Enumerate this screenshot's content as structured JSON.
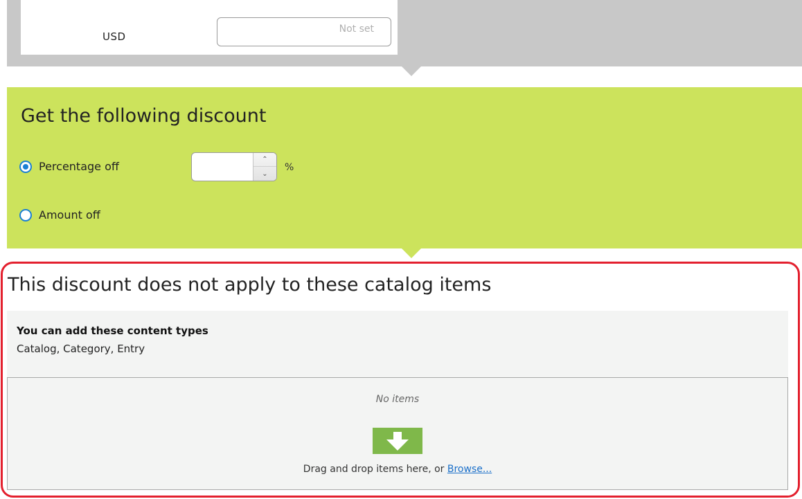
{
  "currency": {
    "code": "USD",
    "value": "",
    "placeholder": "Not set"
  },
  "discount": {
    "title": "Get the following discount",
    "options": [
      {
        "label": "Percentage off",
        "selected": true
      },
      {
        "label": "Amount off",
        "selected": false
      }
    ],
    "percentage_value": "",
    "percentage_unit": "%",
    "stepper_up_glyph": "⌃",
    "stepper_down_glyph": "⌄"
  },
  "exclusions": {
    "title": "This discount does not apply to these catalog items",
    "content_types_heading": "You can add these content types",
    "content_types": "Catalog, Category, Entry",
    "empty_text": "No items",
    "drop_text": "Drag and drop items here, or",
    "browse_label": "Browse..."
  },
  "colors": {
    "discount_panel": "#cce35c",
    "highlight_outline": "#e3202e",
    "drop_icon": "#7fb84a",
    "radio_accent": "#1a7fd4",
    "link": "#1a6fc9"
  },
  "icons": {
    "drop_icon": "download-arrow-icon"
  }
}
